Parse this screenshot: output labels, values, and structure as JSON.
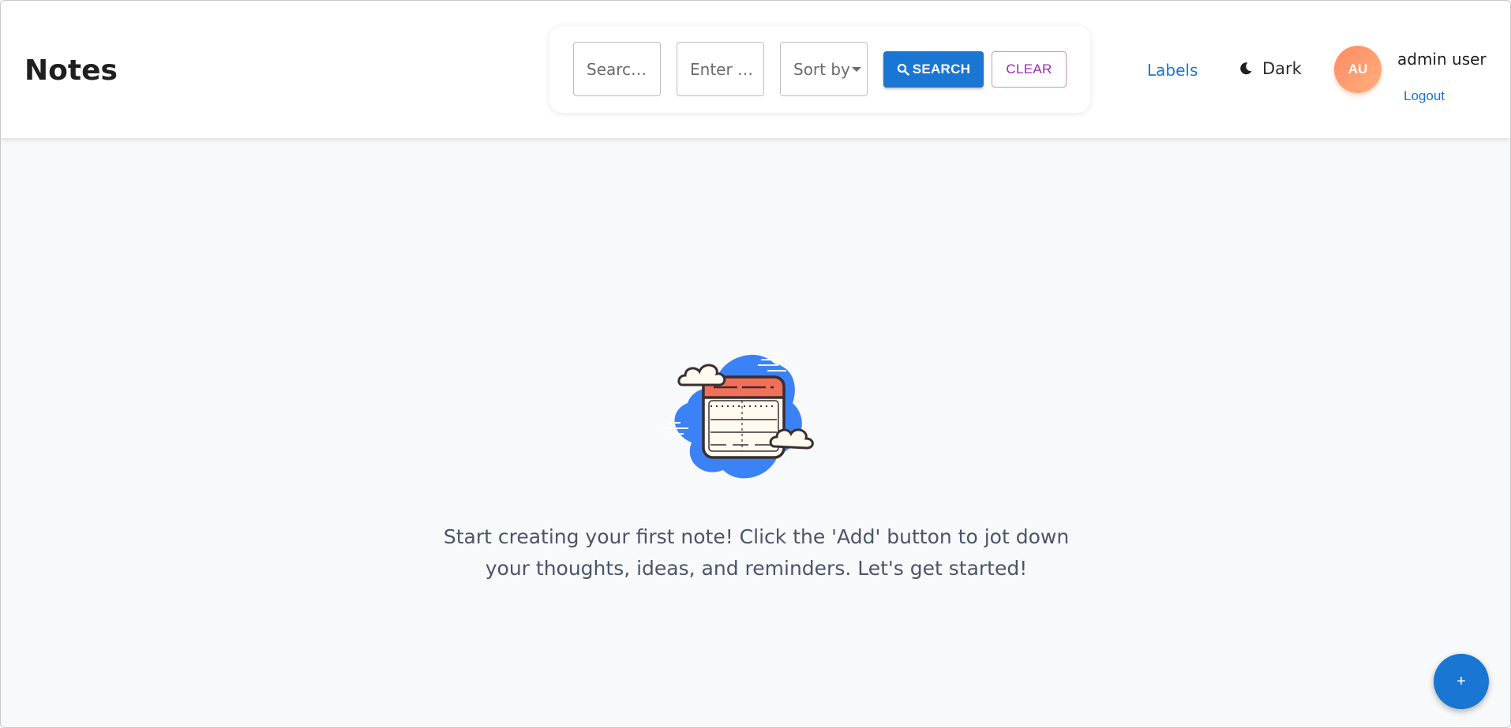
{
  "header": {
    "title": "Notes",
    "search_placeholder": "Search...",
    "tag_placeholder": "Enter t...",
    "sort_label": "Sort by",
    "search_button": "SEARCH",
    "clear_button": "CLEAR",
    "labels_link": "Labels",
    "theme_toggle": "Dark",
    "avatar_initials": "AU",
    "user_name": "admin user",
    "logout_link": "Logout"
  },
  "main": {
    "empty_message": "Start creating your first note! Click the 'Add' button to jot down your thoughts, ideas, and reminders. Let's get started!"
  },
  "fab": {
    "label": "+"
  },
  "icons": {
    "search": "search-icon",
    "theme": "moon-icon",
    "illustration": "notebook-cloud-illustration"
  },
  "colors": {
    "primary": "#1976d2",
    "secondary": "#9c27b0",
    "avatar": "#ff8a65",
    "background": "#f8f9fa"
  }
}
